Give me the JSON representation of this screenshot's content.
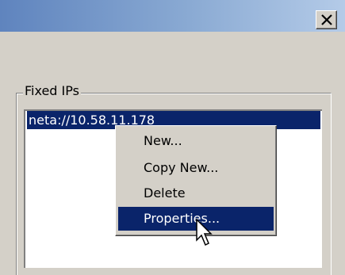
{
  "window": {
    "close_icon": "close-x-icon"
  },
  "group": {
    "label": "Fixed IPs"
  },
  "list": {
    "items": [
      "neta://10.58.11.178"
    ]
  },
  "context_menu": {
    "items": [
      {
        "label": "New..."
      },
      {
        "label": "Copy New..."
      },
      {
        "label": "Delete"
      },
      {
        "label": "Properties..."
      }
    ],
    "selected": "Properties..."
  },
  "cursor_icon": "mouse-pointer-icon"
}
